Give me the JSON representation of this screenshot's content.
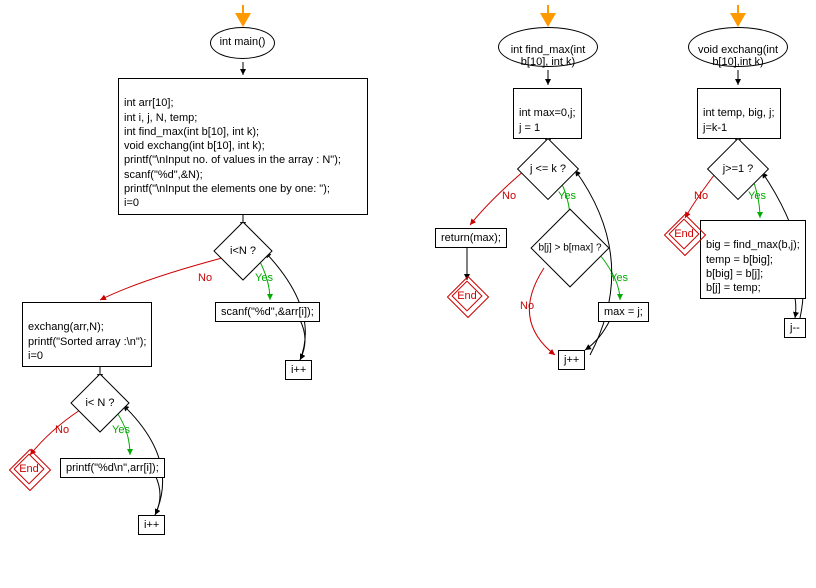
{
  "chart_data": {
    "type": "flowchart",
    "flowcharts": [
      {
        "name": "main",
        "nodes": [
          {
            "id": "main_start",
            "type": "ellipse",
            "text": "int main()"
          },
          {
            "id": "main_decl",
            "type": "process",
            "text": "int arr[10];\nint i, j, N, temp;\nint find_max(int b[10], int k);\nvoid exchang(int b[10], int k);\nprintf(\"\\nInput no. of values in the array : N\");\nscanf(\"%d\",&N);\nprintf(\"\\nInput  the elements one by one: \");\ni=0"
          },
          {
            "id": "main_cond1",
            "type": "decision",
            "text": "i<N ?"
          },
          {
            "id": "main_scan",
            "type": "process",
            "text": "scanf(\"%d\",&arr[i]);"
          },
          {
            "id": "main_inc1",
            "type": "process",
            "text": "i++"
          },
          {
            "id": "main_exchang",
            "type": "process",
            "text": "exchang(arr,N);\nprintf(\"Sorted  array :\\n\");\ni=0"
          },
          {
            "id": "main_cond2",
            "type": "decision",
            "text": "i< N ?"
          },
          {
            "id": "main_print",
            "type": "process",
            "text": "printf(\"%d\\n\",arr[i]);"
          },
          {
            "id": "main_inc2",
            "type": "process",
            "text": "i++"
          },
          {
            "id": "main_end",
            "type": "terminator",
            "text": "End"
          }
        ],
        "edges": [
          {
            "from": "start_arrow",
            "to": "main_start"
          },
          {
            "from": "main_start",
            "to": "main_decl"
          },
          {
            "from": "main_decl",
            "to": "main_cond1"
          },
          {
            "from": "main_cond1",
            "to": "main_scan",
            "label": "Yes"
          },
          {
            "from": "main_scan",
            "to": "main_inc1"
          },
          {
            "from": "main_inc1",
            "to": "main_cond1"
          },
          {
            "from": "main_cond1",
            "to": "main_exchang",
            "label": "No"
          },
          {
            "from": "main_exchang",
            "to": "main_cond2"
          },
          {
            "from": "main_cond2",
            "to": "main_print",
            "label": "Yes"
          },
          {
            "from": "main_print",
            "to": "main_inc2"
          },
          {
            "from": "main_inc2",
            "to": "main_cond2"
          },
          {
            "from": "main_cond2",
            "to": "main_end",
            "label": "No"
          }
        ]
      },
      {
        "name": "find_max",
        "nodes": [
          {
            "id": "fm_start",
            "type": "ellipse",
            "text": "int find_max(int b[10], int k)"
          },
          {
            "id": "fm_init",
            "type": "process",
            "text": "int max=0,j;\nj = 1"
          },
          {
            "id": "fm_cond1",
            "type": "decision",
            "text": "j <= k ?"
          },
          {
            "id": "fm_cond2",
            "type": "decision",
            "text": "b[j] > b[max] ?"
          },
          {
            "id": "fm_assign",
            "type": "process",
            "text": "max = j;"
          },
          {
            "id": "fm_inc",
            "type": "process",
            "text": "j++"
          },
          {
            "id": "fm_return",
            "type": "process",
            "text": "return(max);"
          },
          {
            "id": "fm_end",
            "type": "terminator",
            "text": "End"
          }
        ],
        "edges": [
          {
            "from": "start_arrow",
            "to": "fm_start"
          },
          {
            "from": "fm_start",
            "to": "fm_init"
          },
          {
            "from": "fm_init",
            "to": "fm_cond1"
          },
          {
            "from": "fm_cond1",
            "to": "fm_cond2",
            "label": "Yes"
          },
          {
            "from": "fm_cond2",
            "to": "fm_assign",
            "label": "Yes"
          },
          {
            "from": "fm_assign",
            "to": "fm_inc"
          },
          {
            "from": "fm_cond2",
            "to": "fm_inc",
            "label": "No"
          },
          {
            "from": "fm_inc",
            "to": "fm_cond1"
          },
          {
            "from": "fm_cond1",
            "to": "fm_return",
            "label": "No"
          },
          {
            "from": "fm_return",
            "to": "fm_end"
          }
        ]
      },
      {
        "name": "exchang",
        "nodes": [
          {
            "id": "ex_start",
            "type": "ellipse",
            "text": "void exchang(int b[10],int k)"
          },
          {
            "id": "ex_init",
            "type": "process",
            "text": "int temp, big, j;\nj=k-1"
          },
          {
            "id": "ex_cond",
            "type": "decision",
            "text": "j>=1 ?"
          },
          {
            "id": "ex_body",
            "type": "process",
            "text": "big = find_max(b,j);\ntemp = b[big];\nb[big] = b[j];\nb[j] = temp;"
          },
          {
            "id": "ex_dec",
            "type": "process",
            "text": "j--"
          },
          {
            "id": "ex_end",
            "type": "terminator",
            "text": "End"
          }
        ],
        "edges": [
          {
            "from": "start_arrow",
            "to": "ex_start"
          },
          {
            "from": "ex_start",
            "to": "ex_init"
          },
          {
            "from": "ex_init",
            "to": "ex_cond"
          },
          {
            "from": "ex_cond",
            "to": "ex_body",
            "label": "Yes"
          },
          {
            "from": "ex_body",
            "to": "ex_dec"
          },
          {
            "from": "ex_dec",
            "to": "ex_cond"
          },
          {
            "from": "ex_cond",
            "to": "ex_end",
            "label": "No"
          }
        ]
      }
    ]
  },
  "main": {
    "start": "int main()",
    "decl": "int arr[10];\nint i, j, N, temp;\nint find_max(int b[10], int k);\nvoid exchang(int b[10], int k);\nprintf(\"\\nInput no. of values in the array : N\");\nscanf(\"%d\",&N);\nprintf(\"\\nInput  the elements one by one: \");\ni=0",
    "cond1": "i<N ?",
    "scan": "scanf(\"%d\",&arr[i]);",
    "inc1": "i++",
    "exchang": "exchang(arr,N);\nprintf(\"Sorted  array :\\n\");\ni=0",
    "cond2": "i< N ?",
    "print": "printf(\"%d\\n\",arr[i]);",
    "inc2": "i++",
    "end": "End"
  },
  "find_max": {
    "start": "int find_max(int\nb[10], int k)",
    "init": "int max=0,j;\nj = 1",
    "cond1": "j <= k ?",
    "cond2": "b[j] > b[max] ?",
    "assign": "max = j;",
    "inc": "j++",
    "ret": "return(max);",
    "end": "End"
  },
  "exchang": {
    "start": "void exchang(int\nb[10],int k)",
    "init": "int temp, big, j;\nj=k-1",
    "cond": "j>=1 ?",
    "body": "big = find_max(b,j);\ntemp = b[big];\nb[big] = b[j];\nb[j] = temp;",
    "dec": "j--",
    "end": "End"
  },
  "labels": {
    "yes": "Yes",
    "no": "No"
  }
}
